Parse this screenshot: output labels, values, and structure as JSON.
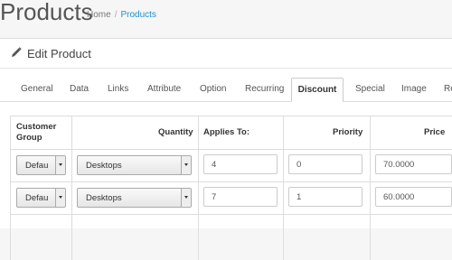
{
  "header": {
    "title": "Products",
    "breadcrumb": [
      "Home",
      "Products"
    ],
    "breadcrumb_separator": "/"
  },
  "panel": {
    "icon": "pencil-icon",
    "title": "Edit Product"
  },
  "tabs": [
    {
      "label": "General",
      "active": false
    },
    {
      "label": "Data",
      "active": false
    },
    {
      "label": "Links",
      "active": false
    },
    {
      "label": "Attribute",
      "active": false
    },
    {
      "label": "Option",
      "active": false
    },
    {
      "label": "Recurring",
      "active": false
    },
    {
      "label": "Discount",
      "active": true
    },
    {
      "label": "Special",
      "active": false
    },
    {
      "label": "Image",
      "active": false
    },
    {
      "label": "Re",
      "active": false
    }
  ],
  "table": {
    "headers": {
      "customer_group": [
        "Customer",
        "Group"
      ],
      "quantity": "Quantity",
      "applies_to": "Applies To:",
      "priority": "Priority",
      "price": "Price"
    },
    "rows": [
      {
        "customer_group": "Defau",
        "product": "Desktops",
        "quantity": "4",
        "priority": "0",
        "price": "70.0000"
      },
      {
        "customer_group": "Defau",
        "product": "Desktops",
        "quantity": "7",
        "priority": "1",
        "price": "60.0000"
      }
    ]
  },
  "colors": {
    "link": "#1e91cf",
    "border": "#dddddd",
    "background": "#f6f6f6"
  }
}
